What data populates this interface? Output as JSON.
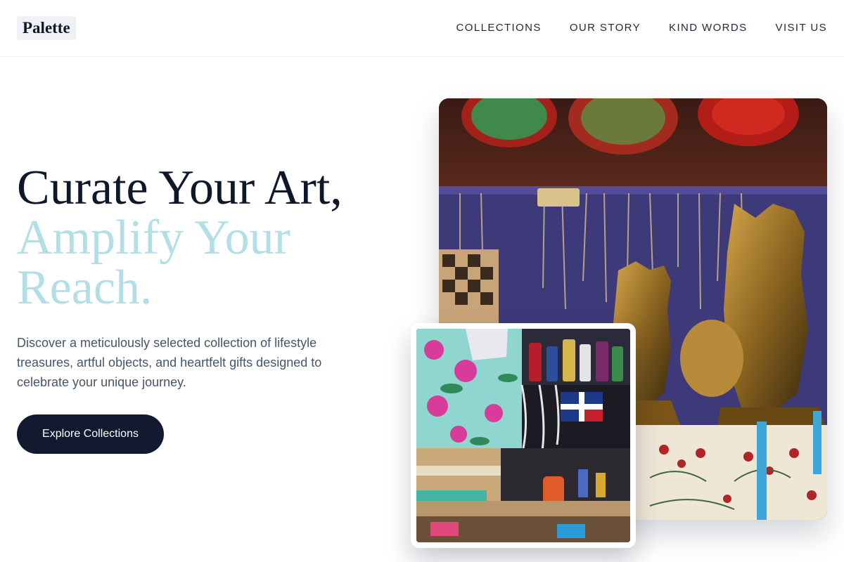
{
  "brand": {
    "name": "Palette"
  },
  "nav": {
    "items": [
      {
        "label": "COLLECTIONS"
      },
      {
        "label": "OUR STORY"
      },
      {
        "label": "KIND WORDS"
      },
      {
        "label": "VISIT US"
      }
    ]
  },
  "hero": {
    "headline_line1": "Curate Your Art,",
    "headline_accent": "Amplify Your Reach.",
    "description": "Discover a meticulously selected collection of lifestyle treasures, artful objects, and heartfelt gifts designed to celebrate your unique journey.",
    "cta_label": "Explore Collections"
  },
  "images": {
    "main": "market stall with jewelry, decorative plates and bronze busts",
    "secondary": "market stall with colorful souvenirs and bottles"
  },
  "colors": {
    "primary": "#0f172a",
    "accent": "#b2dfe6",
    "button": "#111a2e"
  }
}
